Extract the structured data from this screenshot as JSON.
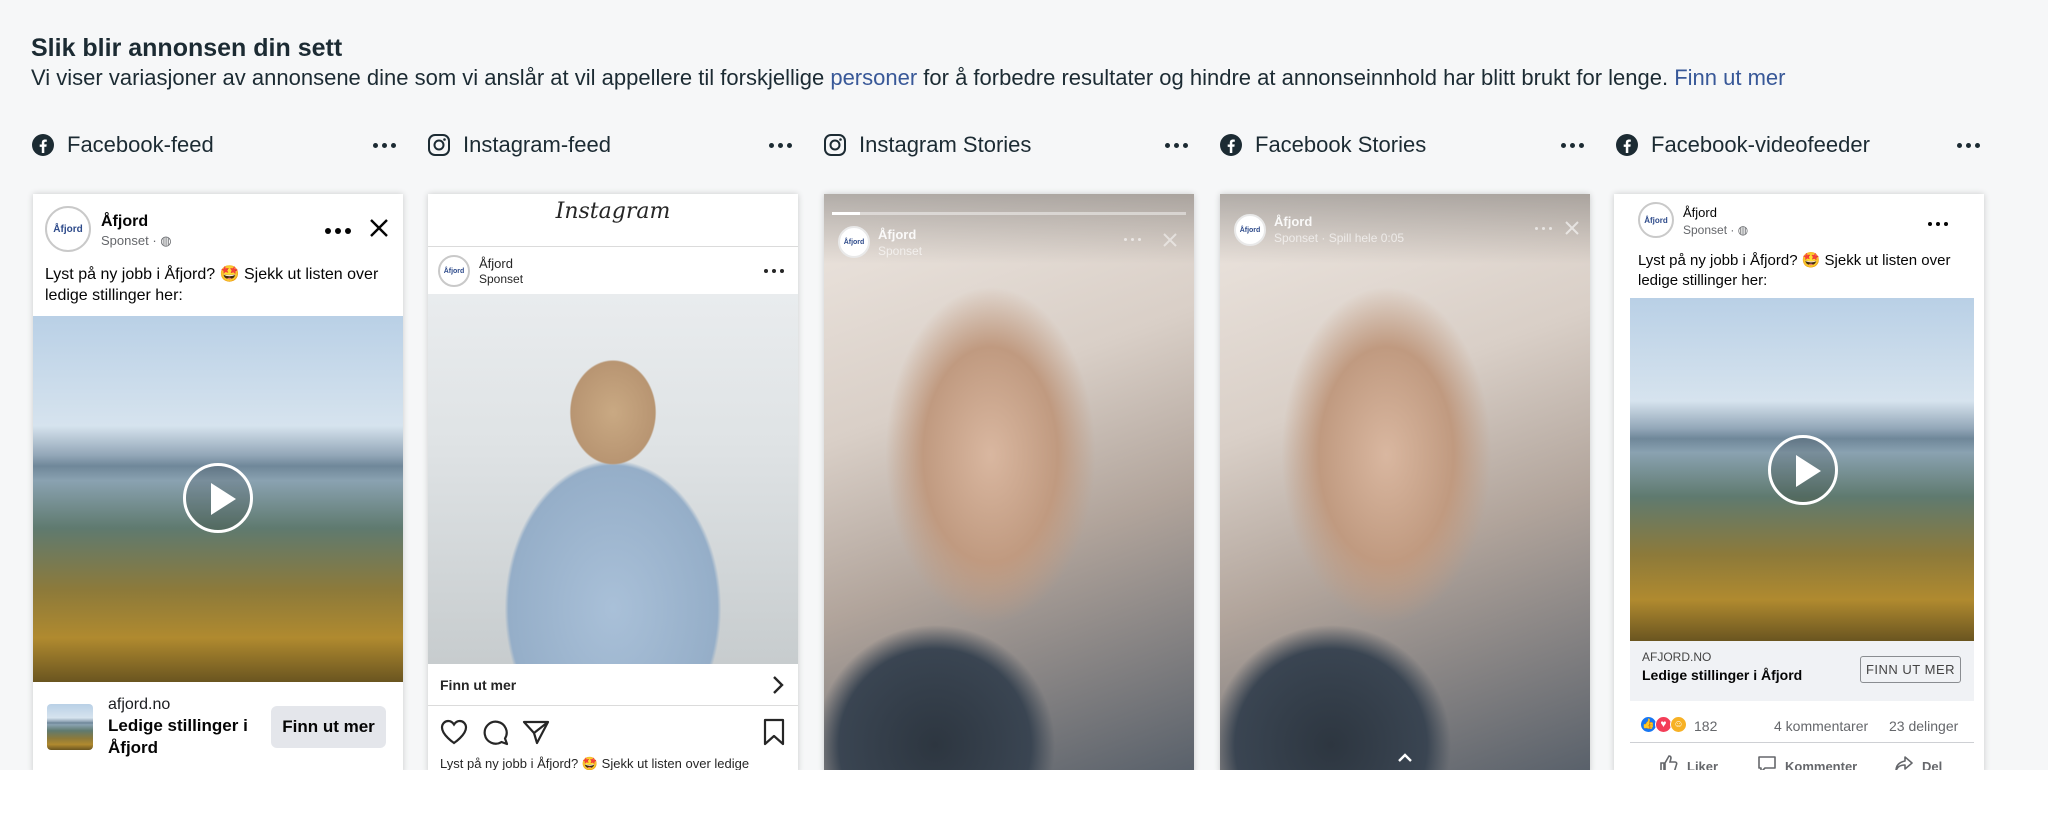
{
  "header": {
    "title": "Slik blir annonsen din sett",
    "desc_part1": "Vi viser variasjoner av annonsene dine som vi anslår at vil appellere til forskjellige ",
    "desc_link1": "personer",
    "desc_part2": " for å forbedre resultater og hindre at annonseinnhold har blitt brukt for lenge. ",
    "desc_link2": "Finn ut mer"
  },
  "placements": [
    {
      "label": "Facebook-feed",
      "icon": "facebook-icon"
    },
    {
      "label": "Instagram-feed",
      "icon": "instagram-icon"
    },
    {
      "label": "Instagram Stories",
      "icon": "instagram-icon"
    },
    {
      "label": "Facebook Stories",
      "icon": "facebook-icon"
    },
    {
      "label": "Facebook-videofeeder",
      "icon": "facebook-icon"
    }
  ],
  "colors": {
    "facebook": "#1c2b33",
    "link": "#385898",
    "background": "#f6f7f8"
  },
  "fb_feed": {
    "page_name": "Åfjord",
    "sponsored": "Sponset · ",
    "avatar_text": "Åfjord",
    "primary_text": "Lyst på ny jobb i Åfjord? 🤩 Sjekk ut listen over ledige stillinger her:",
    "domain": "afjord.no",
    "headline": "Ledige stillinger i Åfjord",
    "cta": "Finn ut mer"
  },
  "ig_feed": {
    "brand": "Instagram",
    "page_name": "Åfjord",
    "sponsored": "Sponset",
    "cta": "Finn ut mer",
    "caption": "Lyst på ny jobb i Åfjord? 🤩 Sjekk ut listen over ledige"
  },
  "ig_stories": {
    "page_name": "Åfjord",
    "sponsored": "Sponset"
  },
  "fb_stories": {
    "page_name": "Åfjord",
    "sponsored": "Sponset · Spill hele 0:05"
  },
  "fb_video": {
    "page_name": "Åfjord",
    "sponsored": "Sponset · ",
    "primary_text": "Lyst på ny jobb i Åfjord? 🤩 Sjekk ut listen over ledige stillinger her:",
    "domain": "AFJORD.NO",
    "headline": "Ledige stillinger i Åfjord",
    "cta": "FINN UT MER",
    "reactions_count": "182",
    "comments": "4 kommentarer",
    "shares": "23 delinger",
    "like": "Liker",
    "comment": "Kommenter",
    "share": "Del"
  }
}
